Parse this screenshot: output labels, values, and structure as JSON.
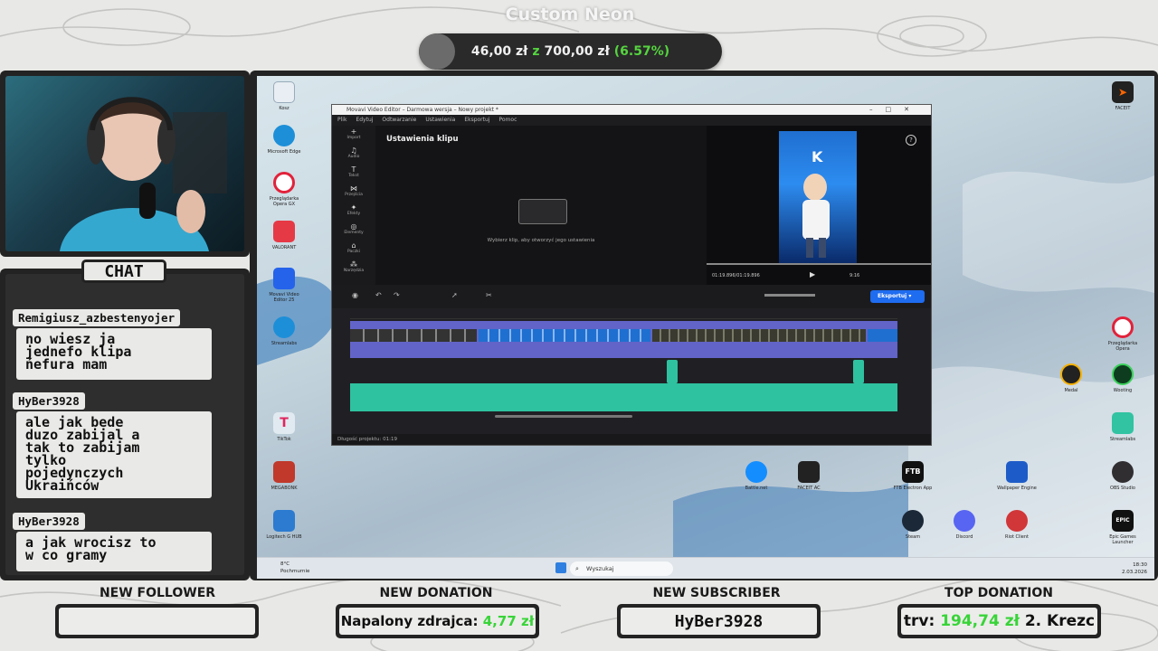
{
  "goal": {
    "title": "Custom Neon",
    "current": "46,00 zł",
    "separator": "z",
    "target": "700,00 zł",
    "percent": "(6.57%)",
    "progress_fraction": 0.0657
  },
  "chat": {
    "label": "CHAT",
    "messages": [
      {
        "user": "Remigiusz_azbestenyojer",
        "text": "no wiesz ja\njednefo klipa\nńefura mam"
      },
      {
        "user": "HyBer3928",
        "text": "ale jak bede\nduzo zabijal a\ntak to zabijam\ntylko\npojedynczych\nUkraińców"
      },
      {
        "user": "HyBer3928",
        "text": "a jak wrocisz to\nw co gramy"
      }
    ]
  },
  "editor": {
    "title": "Movavi Video Editor – Darmowa wersja – Nowy projekt *",
    "menu": [
      "Plik",
      "Edytuj",
      "Odtwarzanie",
      "Ustawienia",
      "Eksportuj",
      "Pomoc"
    ],
    "sidebar": [
      "Import",
      "Audio",
      "Tekst",
      "Przejścia",
      "Efekty",
      "Elementy",
      "Paczki",
      "Narzędzia"
    ],
    "panel_title": "Ustawienia klipu",
    "panel_hint": "Wybierz klip, aby otworzyć jego ustawienia",
    "time": "01:19.896/01:19.896",
    "ratio": "9:16",
    "export_label": "Eksportuj",
    "project_length": "Długość projektu: 01:19"
  },
  "desktop": {
    "icons_left": [
      "Kosz",
      "Microsoft Edge",
      "Przeglądarka Opera GX",
      "VALORANT",
      "Movavi Video Editor 25",
      "Streamlabs",
      "TikTok",
      "MEGABONK",
      "Logitech G HUB"
    ],
    "icons_right": [
      "FACEIT",
      "Przeglądarka Opera",
      "Medal",
      "Wooting",
      "Streamlabs",
      "Battle.net",
      "FACEIT AC",
      "FTB Electron App",
      "Wallpaper Engine",
      "OBS Studio",
      "Steam",
      "Discord",
      "Riot Client",
      "Epic Games Launcher"
    ],
    "search_placeholder": "Wyszukaj",
    "weather_temp": "8°C",
    "weather_desc": "Pochmurnie",
    "clock_time": "18:30",
    "clock_date": "2.03.2026"
  },
  "widgets": {
    "new_follower": {
      "title": "NEW FOLLOWER",
      "value": ""
    },
    "new_donation": {
      "title": "NEW DONATION",
      "name": "Napalony zdrajca:",
      "amount": "4,77 zł"
    },
    "new_subscriber": {
      "title": "NEW SUBSCRIBER",
      "value": "HyBer3928"
    },
    "top_donation": {
      "title": "TOP DONATION",
      "prefix": "trv:",
      "amount": "194,74 zł",
      "next": "2. Krezc"
    }
  },
  "colors": {
    "panel": "#232323",
    "accent_green": "#38d438",
    "export_blue": "#1e6cf0",
    "video_track": "#6264c7",
    "audio_track": "#2ec2a0"
  }
}
